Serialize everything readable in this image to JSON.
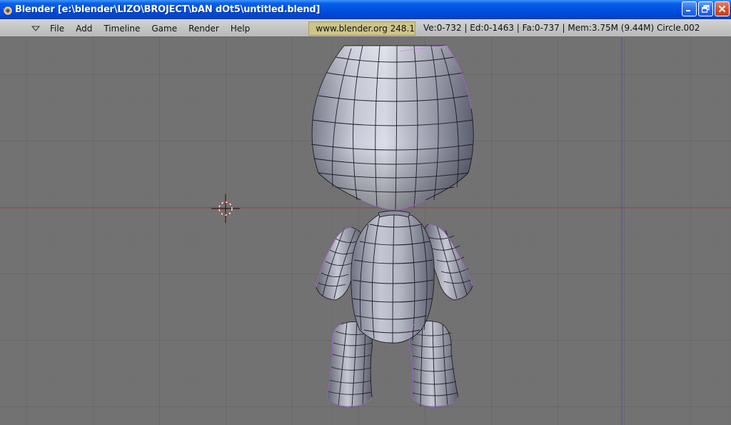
{
  "window": {
    "title": "Blender [e:\\blender\\LIZO\\BROJECT\\bAN dOt5\\untitled.blend]",
    "icon": "blender-logo-icon"
  },
  "menu": {
    "items": [
      "File",
      "Add",
      "Timeline",
      "Game",
      "Render",
      "Help"
    ]
  },
  "header": {
    "site": "www.blender.org 248.1",
    "stats": "Ve:0-732 | Ed:0-1463 | Fa:0-737 | Mem:3.75M (9.44M) Circle.002"
  },
  "colors": {
    "viewport_bg": "#727272",
    "grid_line": "#666666",
    "x_axis": "#a05050",
    "y_axis": "#4d4da0",
    "vertex": "#d080ff",
    "mesh": "#a8adbd"
  },
  "viewport": {
    "cursor": "3d-cursor-icon",
    "object": "sackboy-mesh"
  }
}
